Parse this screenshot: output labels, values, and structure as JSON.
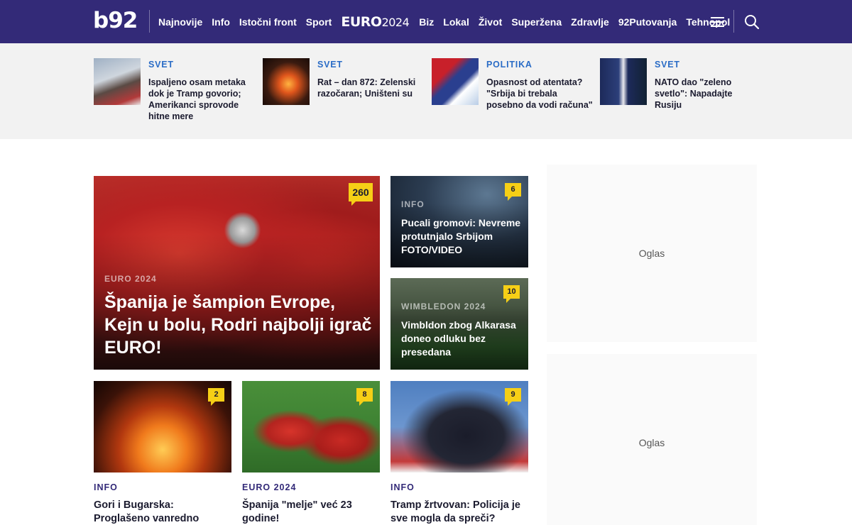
{
  "header": {
    "logo": "b92",
    "nav": [
      "Najnovije",
      "Info",
      "Istočni front",
      "Sport"
    ],
    "euro_logo": {
      "word": "EURO",
      "year": "2024"
    },
    "nav2": [
      "Biz",
      "Lokal",
      "Život",
      "Superžena",
      "Zdravlje",
      "92Putovanja",
      "Tehnopolis"
    ],
    "icons": {
      "menu": "hamburger-menu-icon",
      "search": "search-icon"
    },
    "colors": {
      "header_bg": "#332a78",
      "accent_category": "#2a6cc6",
      "badge": "#f6cf16"
    }
  },
  "top_strip": [
    {
      "category": "SVET",
      "title": "Ispaljeno osam metaka dok je Tramp govorio; Amerikanci sprovode hitne mere"
    },
    {
      "category": "SVET",
      "title": "Rat – dan 872: Zelenski razočaran; Uništeni su"
    },
    {
      "category": "POLITIKA",
      "title": "Opasnost od atentata? \"Srbija bi trebala posebno da vodi računa\""
    },
    {
      "category": "SVET",
      "title": "NATO dao \"zeleno svetlo\": Napadajte Rusiju"
    }
  ],
  "hero": {
    "category": "EURO 2024",
    "title": "Španija je šampion Evrope, Kejn u bolu, Rodri najbolji igrač EURO!",
    "comments": "260"
  },
  "side_cards": [
    {
      "category": "INFO",
      "title": "Pucali gromovi: Nevreme protutnjalo Srbijom FOTO/VIDEO",
      "comments": "6"
    },
    {
      "category": "WIMBLEDON 2024",
      "title": "Vimbldon zbog Alkarasa doneo odluku bez presedana",
      "comments": "10"
    }
  ],
  "bottom_cards": [
    {
      "category": "INFO",
      "title": "Gori i Bugarska: Proglašeno vanredno stanje; vatrogasci",
      "comments": "2"
    },
    {
      "category": "EURO 2024",
      "title": "Španija \"melje\" već 23 godine!",
      "comments": "8"
    },
    {
      "category": "INFO",
      "title": "Tramp žrtvovan: Policija je sve mogla da spreči?",
      "comments": "9"
    }
  ],
  "ads": [
    {
      "label": "Oglas"
    },
    {
      "label": "Oglas"
    }
  ]
}
